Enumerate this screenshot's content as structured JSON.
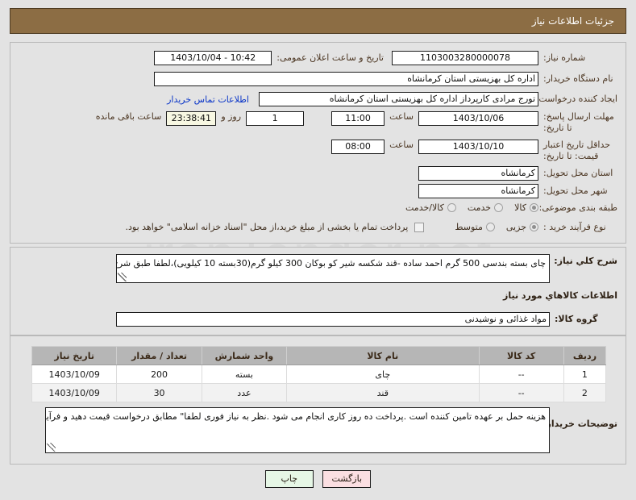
{
  "header": {
    "title": "جزئیات اطلاعات نیاز"
  },
  "watermark": "iranTender.net",
  "colors": {
    "header_bg": "#8c6d44",
    "page_bg": "#e3e3e3",
    "label": "#4b3521",
    "link": "#0a35c8",
    "table_header_bg": "#b6b6b6",
    "print_btn_bg": "#e6f7e6",
    "back_btn_bg": "#fbdfe2",
    "countdown_bg": "#f7f7e2"
  },
  "main": {
    "need_number": {
      "label": "شماره نیاز:",
      "value": "1103003280000078"
    },
    "public_announce": {
      "label": "تاریخ و ساعت اعلان عمومی:",
      "value": "10:42 - 1403/10/04"
    },
    "buyer_org": {
      "label": "نام دستگاه خریدار:",
      "value": "اداره کل بهزیستی استان کرمانشاه"
    },
    "requester": {
      "label": "ایجاد کننده درخواست:",
      "value": "تورج مرادی کارپرداز  اداره کل بهزیستی استان کرمانشاه",
      "contact_link": "اطلاعات تماس خریدار"
    },
    "response_deadline": {
      "label": "مهلت ارسال پاسخ: تا تاریخ:",
      "date": "1403/10/06",
      "time_label": "ساعت",
      "time": "11:00",
      "days": "1",
      "days_sep": "روز و",
      "countdown": "23:38:41",
      "countdown_label": "ساعت باقی مانده"
    },
    "price_validity": {
      "label": "حداقل تاریخ اعتبار قیمت: تا تاریخ:",
      "date": "1403/10/10",
      "time_label": "ساعت",
      "time": "08:00"
    },
    "delivery_province": {
      "label": "استان محل تحویل:",
      "value": "کرمانشاه"
    },
    "delivery_city": {
      "label": "شهر محل تحویل:",
      "value": "کرمانشاه"
    },
    "subject_category": {
      "label": "طبقه بندی موضوعی:",
      "options": [
        {
          "text": "کالا",
          "selected": true
        },
        {
          "text": "خدمت",
          "selected": false
        },
        {
          "text": "کالا/خدمت",
          "selected": false
        }
      ]
    },
    "purchase_type": {
      "label": "نوع فرآیند خرید :",
      "options": [
        {
          "text": "جزیی",
          "selected": true
        },
        {
          "text": "متوسط",
          "selected": false
        }
      ],
      "treasury_checkbox": {
        "checked": false,
        "text": "پرداخت تمام یا بخشی از مبلغ خرید،از محل \"اسناد خزانه اسلامی\" خواهد بود."
      }
    }
  },
  "description": {
    "need_summary_label": "شرح کلي نياز:",
    "need_summary_value": "چای بسته بندسی 500 گرم احمد ساده -قند شکسه شیر کو بوکان  300 کیلو گرم(30بسته 10 کیلویی)،لطفا طبق  شرح کلی نیاز قیمت دهید",
    "items_info_title": "اطلاعات کالاهاي مورد نیاز",
    "goods_group_label": "گروه کالا:",
    "goods_group_value": "مواد غذائی و نوشیدنی"
  },
  "items_table": {
    "columns": [
      "ردیف",
      "کد کالا",
      "نام کالا",
      "واحد شمارش",
      "تعداد / مقدار",
      "تاریخ نیاز"
    ],
    "rows": [
      {
        "row": "1",
        "code": "--",
        "name": "چای",
        "unit": "بسته",
        "qty": "200",
        "date": "1403/10/09"
      },
      {
        "row": "2",
        "code": "--",
        "name": "قند",
        "unit": "عدد",
        "qty": "30",
        "date": "1403/10/09"
      }
    ]
  },
  "buyer_notes": {
    "label": "توضیحات خریدار:",
    "value": "هزینه حمل بر عهده تامین کننده است .پرداخت ده روز کاری انجام می شود .نظر به نیاز فوری لطفا\" مطابق درخواست قیمت دهید و فرآیند خرید را طولانی نفرمائید.فاکتور باید ثبت سامانه مودیان گردد. تاریخ تولید و انقضاء با بهترین زمان مصرف باید بر روی جلد حک باشد."
  },
  "buttons": {
    "print": "چاپ",
    "back": "بازگشت"
  }
}
